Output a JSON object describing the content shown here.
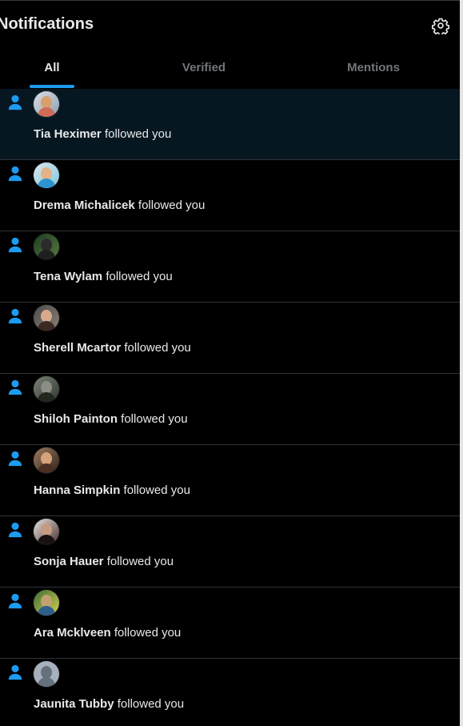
{
  "header": {
    "title": "Notifications",
    "settings_icon": "gear-icon"
  },
  "tabs": [
    {
      "label": "All",
      "selected": true
    },
    {
      "label": "Verified",
      "selected": false
    },
    {
      "label": "Mentions",
      "selected": false
    }
  ],
  "notifications": [
    {
      "name": "Tia Heximer",
      "action": "followed you",
      "highlighted": true
    },
    {
      "name": "Drema Michalicek",
      "action": "followed you"
    },
    {
      "name": "Tena Wylam",
      "action": "followed you"
    },
    {
      "name": "Sherell Mcartor",
      "action": "followed you"
    },
    {
      "name": "Shiloh Painton",
      "action": "followed you"
    },
    {
      "name": "Hanna Simpkin",
      "action": "followed you"
    },
    {
      "name": "Sonja Hauer",
      "action": "followed you"
    },
    {
      "name": "Ara Mcklveen",
      "action": "followed you"
    },
    {
      "name": "Jaunita Tubby",
      "action": "followed you"
    }
  ],
  "colors": {
    "accent": "#1d9bf0",
    "background": "#000000",
    "highlight": "#071722",
    "muted": "#71767b",
    "text": "#e7e9ea"
  }
}
